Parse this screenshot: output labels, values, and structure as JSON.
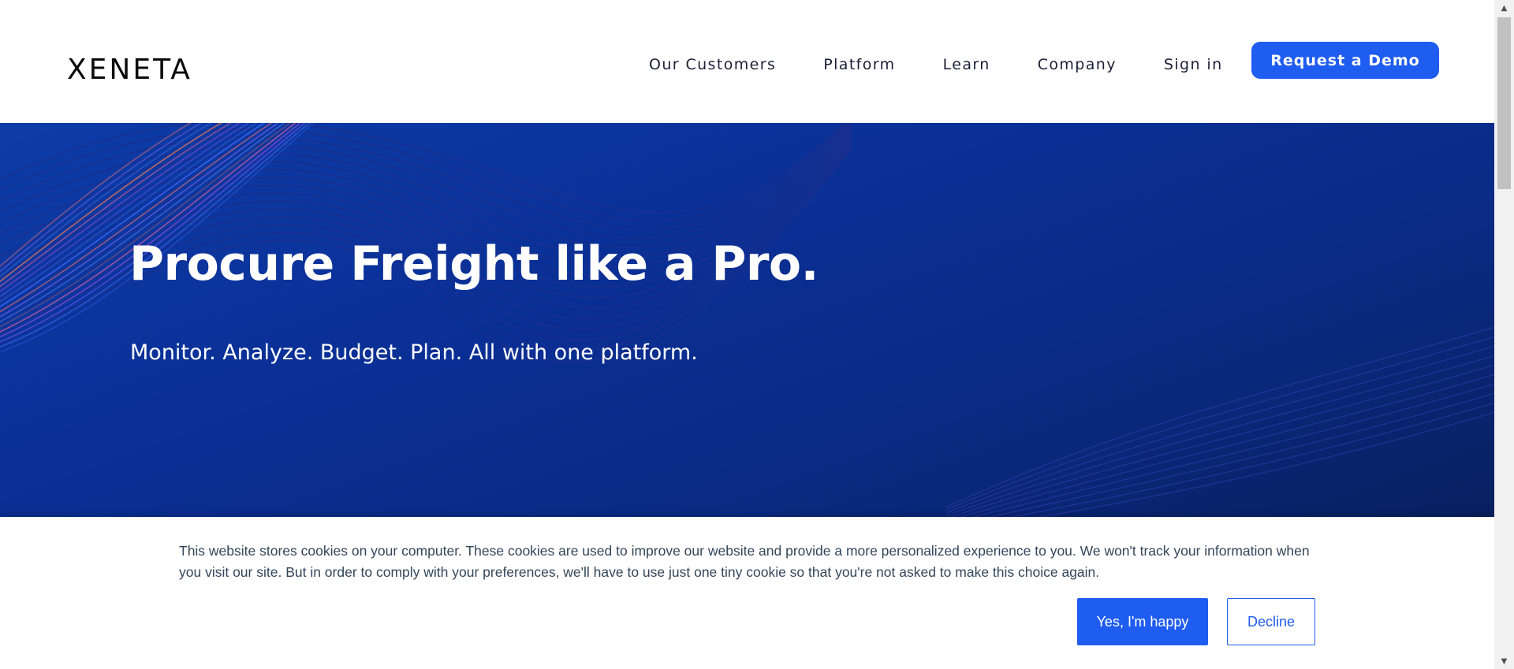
{
  "header": {
    "logo_text": "XENETA",
    "nav": [
      {
        "label": "Our Customers"
      },
      {
        "label": "Platform"
      },
      {
        "label": "Learn"
      },
      {
        "label": "Company"
      },
      {
        "label": "Sign in"
      }
    ],
    "cta_label": "Request a Demo"
  },
  "hero": {
    "title": "Procure Freight like a Pro.",
    "subtitle": "Monitor. Analyze. Budget. Plan. All with one platform."
  },
  "cookie_banner": {
    "text": "This website stores cookies on your computer. These cookies are used to improve our website and provide a more personalized experience to you. We won't track your information when you visit our site. But in order to comply with your preferences, we'll have to use just one tiny cookie so that you're not asked to make this choice again.",
    "accept_label": "Yes, I'm happy",
    "decline_label": "Decline"
  },
  "scrollbar": {
    "up_icon": "triangle-up-icon",
    "down_icon": "triangle-down-icon"
  },
  "colors": {
    "brand_blue": "#1f5cf0",
    "hero_dark": "#0a2a82",
    "text_dark": "#1a1f36",
    "cookie_text": "#33475b"
  }
}
